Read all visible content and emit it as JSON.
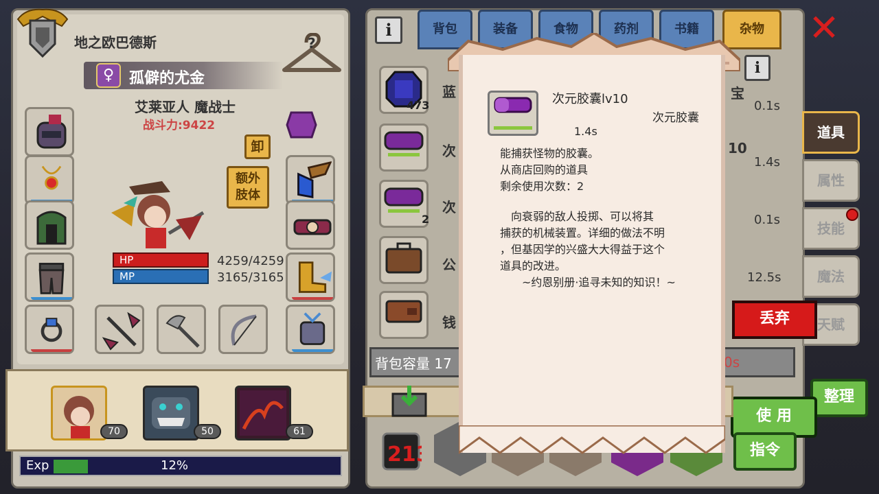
{
  "character": {
    "name": "地之欧巴德斯",
    "title": "孤僻的尤金",
    "race_class": "艾莱亚人 魔战士",
    "power": "战斗力:9422",
    "unequip_label": "卸",
    "extra_limbs_label": "额外\n肢体",
    "hp_label": "HP",
    "hp_value": "4259/4259",
    "mp_label": "MP",
    "mp_value": "3165/3165"
  },
  "party": [
    {
      "level": "70"
    },
    {
      "level": "50"
    },
    {
      "level": "61"
    }
  ],
  "exp": {
    "label": "Exp",
    "percent_text": "12%",
    "fraction": 0.12
  },
  "tabs": [
    "背包",
    "装备",
    "食物",
    "药剂",
    "书籍",
    "杂物"
  ],
  "active_tab": "杂物",
  "items": [
    {
      "name": "蓝",
      "count": "473",
      "time": "0.1s",
      "extra": "宝"
    },
    {
      "name": "次",
      "count": "",
      "time": "1.4s",
      "extra": "10"
    },
    {
      "name": "次",
      "count": "2",
      "time": "0.1s",
      "extra": ""
    },
    {
      "name": "公",
      "count": "",
      "time": "12.5s",
      "extra": ""
    },
    {
      "name": "钱",
      "count": "",
      "time": "",
      "extra": ""
    }
  ],
  "capacity_label": "背包容量 17",
  "capacity_right": "0s",
  "side_tabs": [
    "道具",
    "属性",
    "技能",
    "魔法",
    "天赋"
  ],
  "buttons": {
    "discard": "丢弃",
    "use": "使 用",
    "sort": "整理",
    "command": "指令"
  },
  "popup": {
    "title": "次元胶囊lv10",
    "type": "次元胶囊",
    "weight": "1.4s",
    "desc": [
      "能捕获怪物的胶囊。",
      "从商店回购的道具",
      "剩余使用次数：2"
    ],
    "lore": [
      "　向衰弱的敌人投掷、可以将其",
      "捕获的机械装置。详细的做法不明",
      "，但基因学的兴盛大大得益于这个",
      "道具的改进。",
      "　　~约恩别册·追寻未知的知识！~"
    ]
  },
  "colors": {
    "hp": "#cc1e1e",
    "mp": "#2a6fb5",
    "active_tab": "#e9b64a",
    "discard": "#d61a1a",
    "use": "#6fbf4a"
  }
}
